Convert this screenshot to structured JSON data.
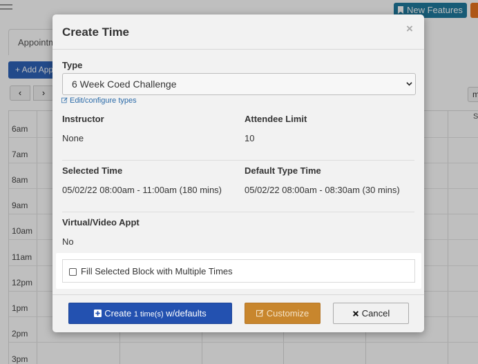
{
  "background": {
    "top_button": "New Features",
    "tab_label": "Appointments",
    "add_button": "+ Add Appt",
    "nav": {
      "prev": "‹",
      "next": "›"
    },
    "right_button": "m",
    "right_col_label": "S",
    "times": [
      "6am",
      "7am",
      "8am",
      "9am",
      "10am",
      "11am",
      "12pm",
      "1pm",
      "2pm",
      "3pm"
    ]
  },
  "modal": {
    "title": "Create Time",
    "close": "×",
    "type": {
      "label": "Type",
      "selected": "6 Week Coed Challenge",
      "edit_link": "Edit/configure types"
    },
    "instructor": {
      "label": "Instructor",
      "value": "None"
    },
    "attendee_limit": {
      "label": "Attendee Limit",
      "value": "10"
    },
    "selected_time": {
      "label": "Selected Time",
      "value": "05/02/22 08:00am - 11:00am (180 mins)"
    },
    "default_type_time": {
      "label": "Default Type Time",
      "value": "05/02/22 08:00am - 08:30am (30 mins)"
    },
    "virtual": {
      "label": "Virtual/Video Appt",
      "value": "No"
    },
    "fill_checkbox": {
      "label": "Fill Selected Block with Multiple Times",
      "checked": false
    },
    "buttons": {
      "create_prefix": "Create",
      "create_count": "1 time(s)",
      "create_suffix": "w/defaults",
      "customize": "Customize",
      "cancel": "Cancel"
    }
  },
  "colors": {
    "primary": "#2351b0",
    "warning": "#c8862d",
    "link": "#2a6aa8"
  }
}
